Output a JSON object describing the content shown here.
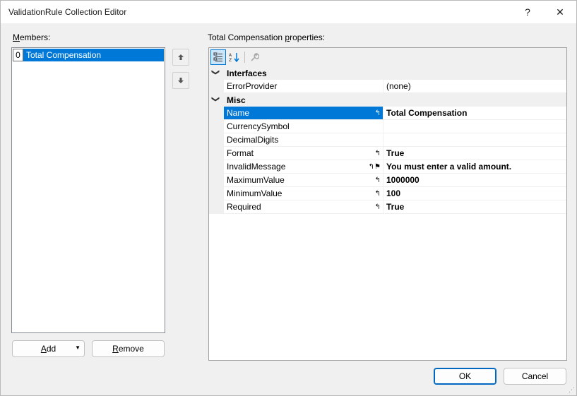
{
  "window": {
    "title": "ValidationRule Collection Editor",
    "help_glyph": "?",
    "close_glyph": "✕"
  },
  "members": {
    "label_prefix": "",
    "label_accel": "M",
    "label_rest": "embers:",
    "items": [
      {
        "index": "0",
        "name": "Total Compensation"
      }
    ]
  },
  "move_up_icon": "arrow-up-icon",
  "move_down_icon": "arrow-down-icon",
  "buttons": {
    "add_accel": "A",
    "add_rest": "dd",
    "remove_accel": "R",
    "remove_rest": "emove",
    "ok": "OK",
    "cancel": "Cancel"
  },
  "properties": {
    "label_prefix": "Total Compensation ",
    "label_accel": "p",
    "label_rest": "roperties:",
    "categories": [
      {
        "name": "Interfaces",
        "rows": [
          {
            "name": "ErrorProvider",
            "value": "(none)",
            "bold": false,
            "mark": ""
          }
        ]
      },
      {
        "name": "Misc",
        "rows": [
          {
            "name": "Name",
            "value": "Total Compensation",
            "bold": true,
            "mark": "↰"
          },
          {
            "name": "CurrencySymbol",
            "value": "",
            "bold": false,
            "mark": ""
          },
          {
            "name": "DecimalDigits",
            "value": "",
            "bold": false,
            "mark": ""
          },
          {
            "name": "Format",
            "value": "True",
            "bold": true,
            "mark": "↰"
          },
          {
            "name": "InvalidMessage",
            "value": "You must enter a valid amount.",
            "bold": true,
            "mark": "↰⚑"
          },
          {
            "name": "MaximumValue",
            "value": "1000000",
            "bold": true,
            "mark": "↰"
          },
          {
            "name": "MinimumValue",
            "value": "100",
            "bold": true,
            "mark": "↰"
          },
          {
            "name": "Required",
            "value": "True",
            "bold": true,
            "mark": "↰"
          }
        ]
      }
    ]
  },
  "colors": {
    "selection": "#0078d7",
    "default_button_border": "#0067c0"
  }
}
